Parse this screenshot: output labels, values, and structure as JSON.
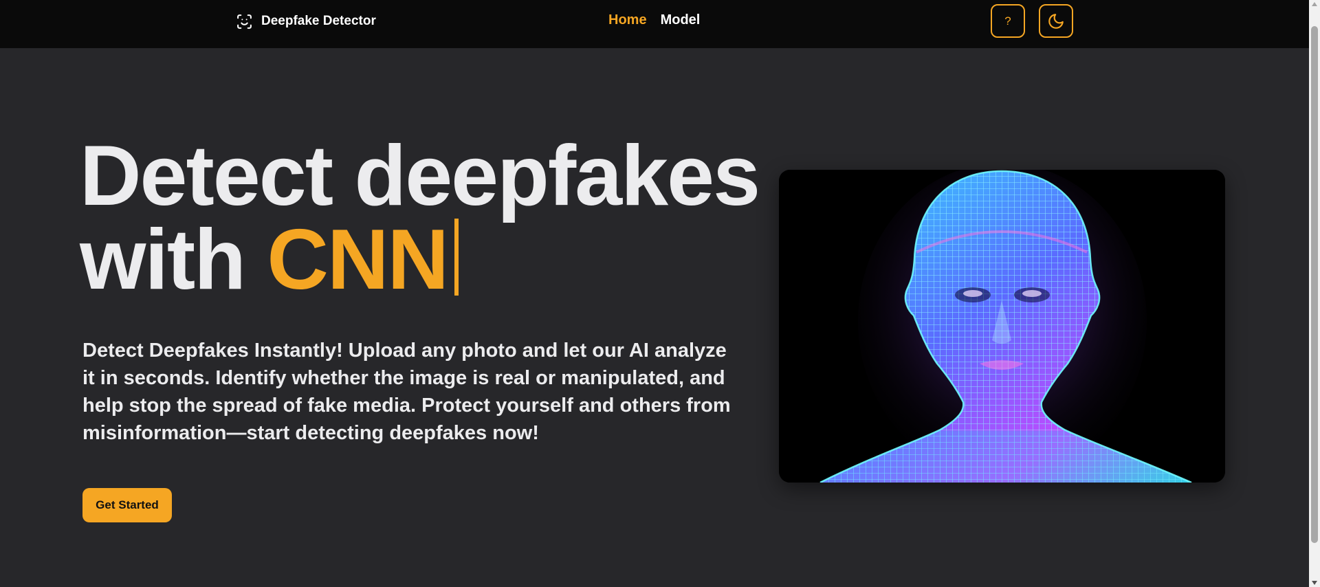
{
  "navbar": {
    "brand": {
      "icon": "face-scan-icon",
      "label": "Deepfake Detector"
    },
    "links": [
      {
        "label": "Home",
        "active": true
      },
      {
        "label": "Model",
        "active": false
      }
    ],
    "help_button": {
      "label": "?",
      "icon": "help-icon"
    },
    "theme_button": {
      "icon": "moon-icon"
    }
  },
  "hero": {
    "title_line1": "Detect deepfakes",
    "title_line2_prefix": "with ",
    "title_line2_accent": "CNN",
    "description": "Detect Deepfakes Instantly! Upload any photo and let our AI analyze it in seconds. Identify whether the image is real or manipulated, and help stop the spread of fake media. Protect yourself and others from misinformation—start detecting deepfakes now!",
    "cta_label": "Get Started",
    "image": {
      "subject": "wireframe-head-image"
    }
  },
  "colors": {
    "accent": "#f5a623",
    "nav_background": "#0a0a0a",
    "page_background": "#27272a",
    "text": "#ececee"
  }
}
